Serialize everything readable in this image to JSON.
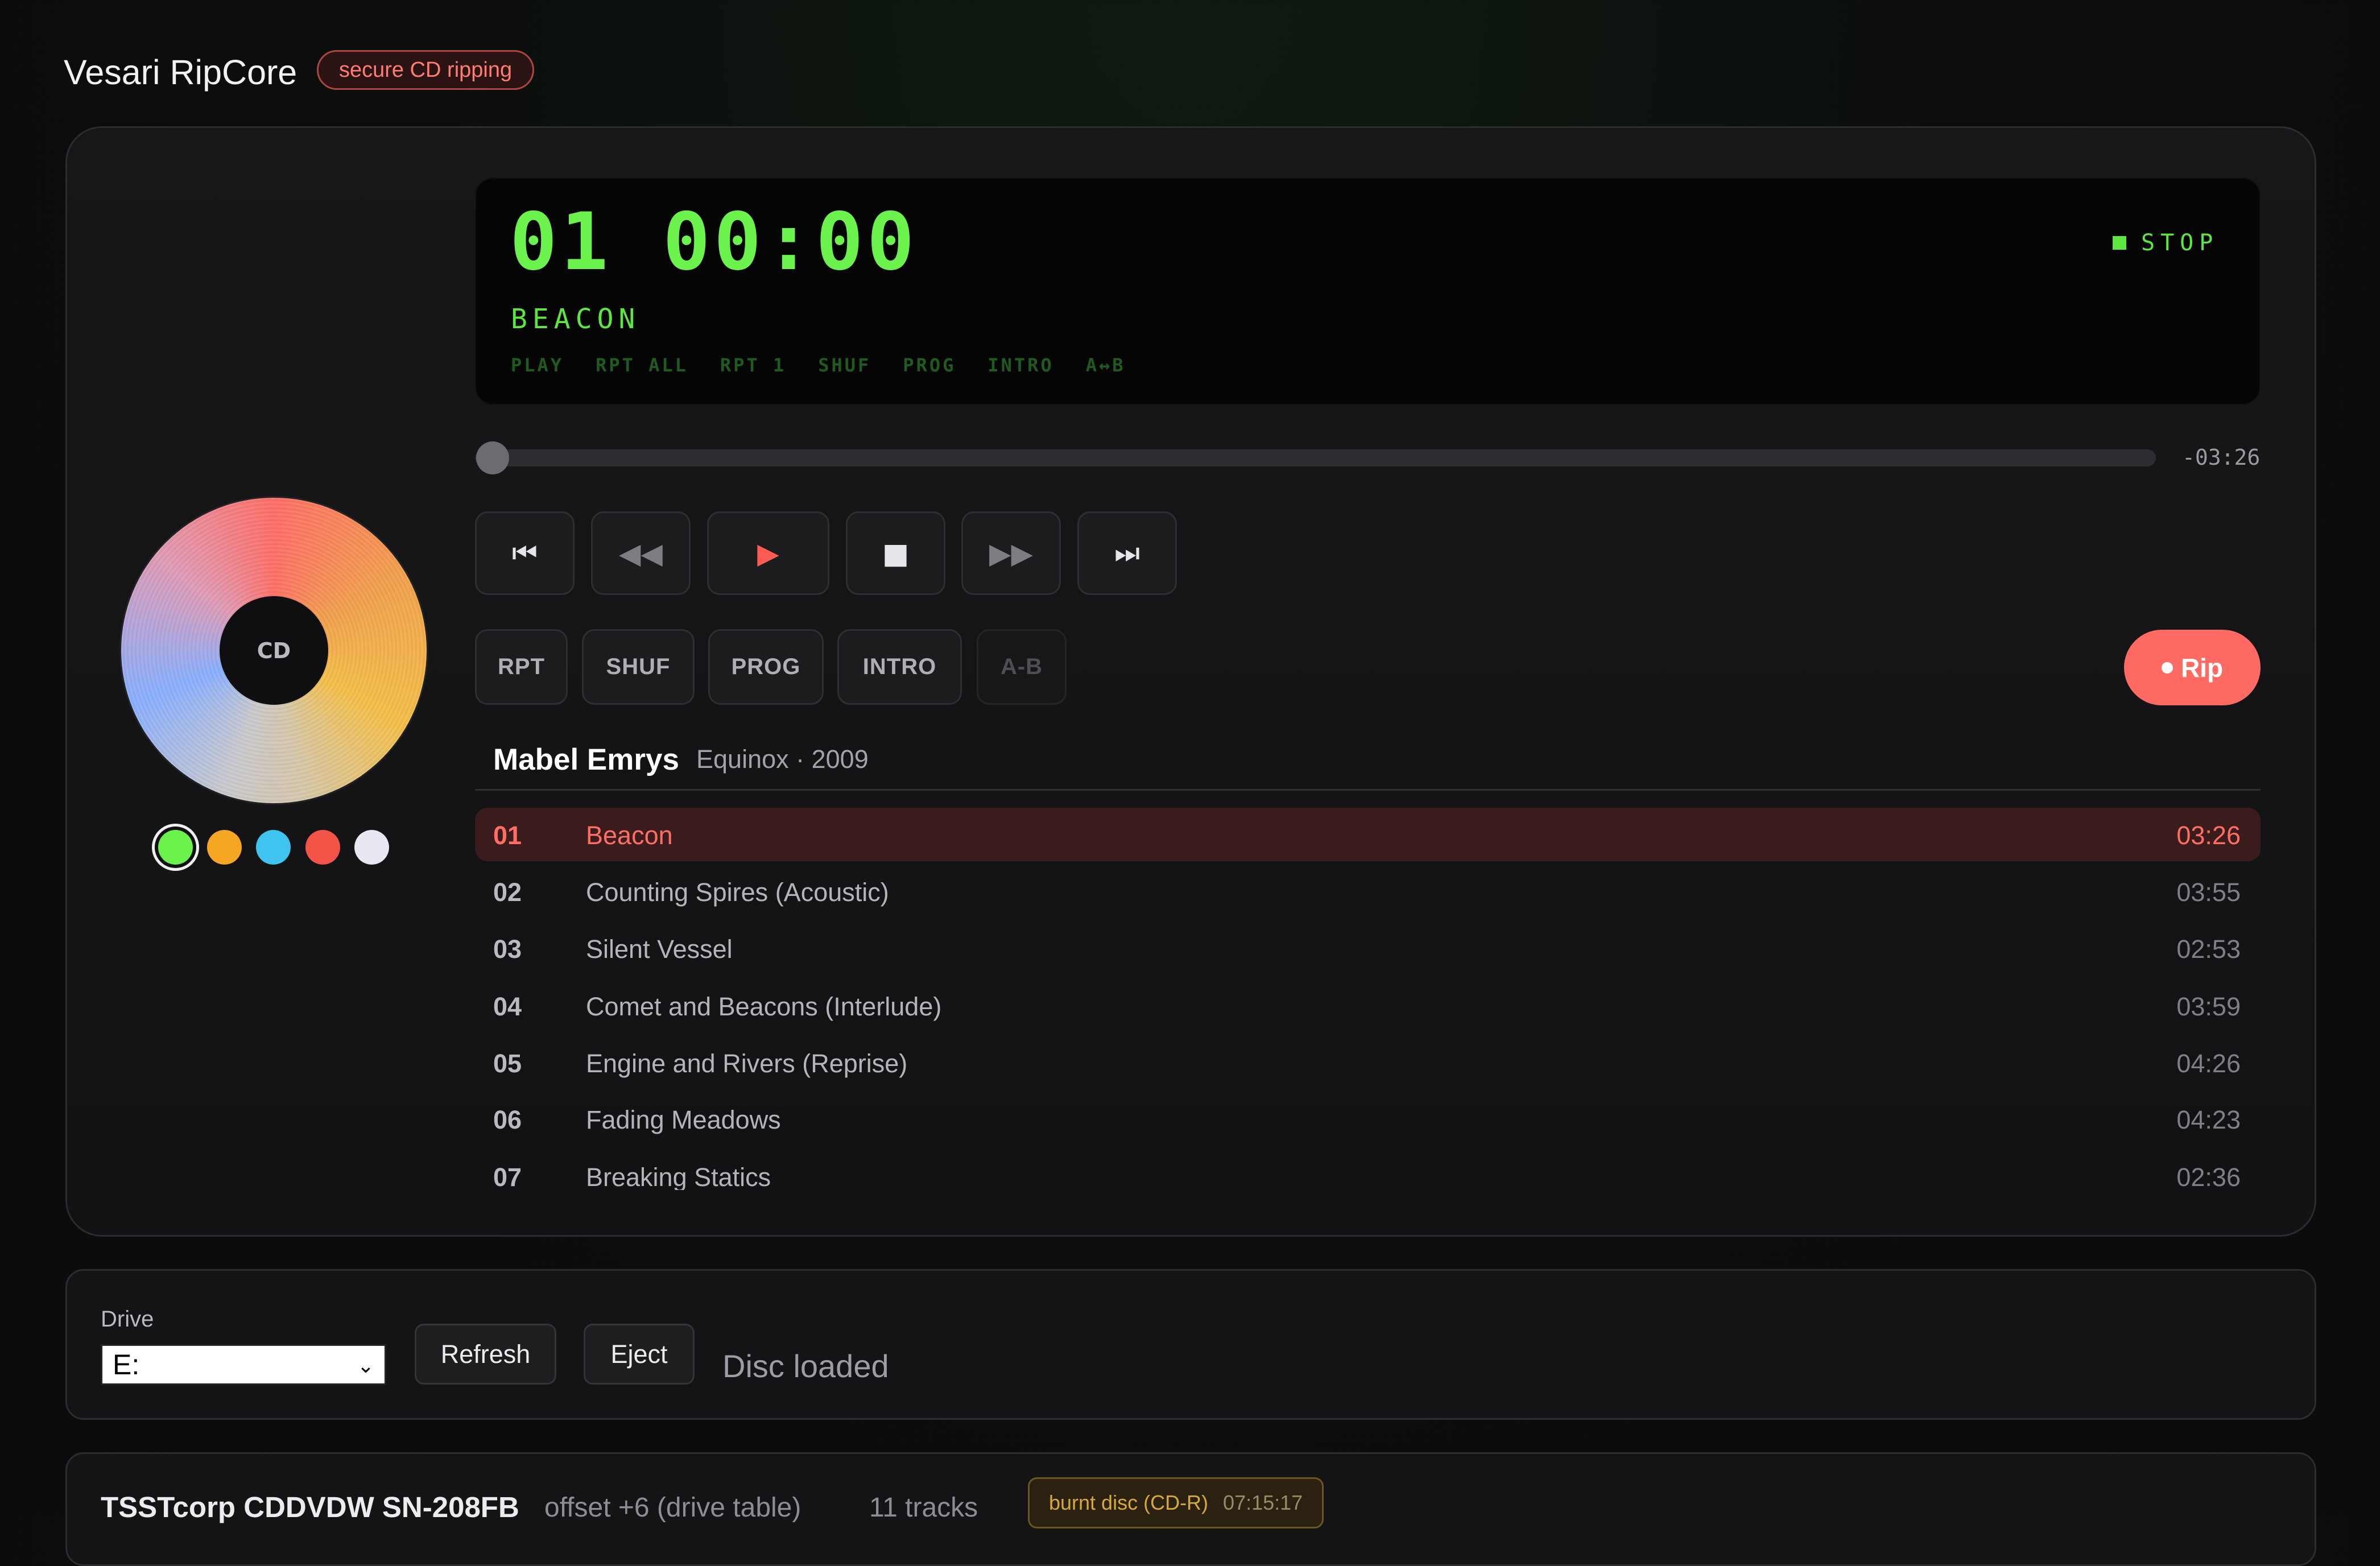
{
  "app": {
    "title": "Vesari RipCore",
    "badge": "secure CD ripping"
  },
  "disc": {
    "hub_label": "CD",
    "swatches": [
      "#6cf24d",
      "#f5a623",
      "#3fc3ef",
      "#f25448",
      "#e8e8f2"
    ],
    "selected_swatch": 0
  },
  "lcd": {
    "track_number": "01",
    "time": "00:00",
    "track_name": "BEACON",
    "modes": [
      "PLAY",
      "RPT ALL",
      "RPT 1",
      "SHUF",
      "PROG",
      "INTRO",
      "A↔B"
    ],
    "state": "STOP"
  },
  "seek": {
    "remaining": "-03:26",
    "progress": 0
  },
  "transport": {
    "prev": "⏮",
    "rewind": "◀◀",
    "play": "▶",
    "stop": "■",
    "forward": "▶▶",
    "next": "⏭"
  },
  "modes": {
    "repeat": "RPT",
    "shuffle": "SHUF",
    "program": "PROG",
    "intro": "INTRO",
    "ab": "A-B"
  },
  "rip": {
    "label": "Rip"
  },
  "album": {
    "artist": "Mabel Emrys",
    "info": "Equinox · 2009"
  },
  "tracks": [
    {
      "num": "01",
      "title": "Beacon",
      "duration": "03:26"
    },
    {
      "num": "02",
      "title": "Counting Spires (Acoustic)",
      "duration": "03:55"
    },
    {
      "num": "03",
      "title": "Silent Vessel",
      "duration": "02:53"
    },
    {
      "num": "04",
      "title": "Comet and Beacons (Interlude)",
      "duration": "03:59"
    },
    {
      "num": "05",
      "title": "Engine and Rivers (Reprise)",
      "duration": "04:26"
    },
    {
      "num": "06",
      "title": "Fading Meadows",
      "duration": "04:23"
    },
    {
      "num": "07",
      "title": "Breaking Statics",
      "duration": "02:36"
    }
  ],
  "drive": {
    "label": "Drive",
    "selected": "E:",
    "refresh": "Refresh",
    "eject": "Eject",
    "status": "Disc loaded"
  },
  "info": {
    "model": "TSSTcorp CDDVDW SN-208FB",
    "offset": "offset +6 (drive table)",
    "tracks": "11 tracks",
    "badge": "burnt disc (CD-R)",
    "badge_time": "07:15:17"
  },
  "colors": {
    "accent": "#ff6b62",
    "lcd_green": "#6cf24d"
  }
}
